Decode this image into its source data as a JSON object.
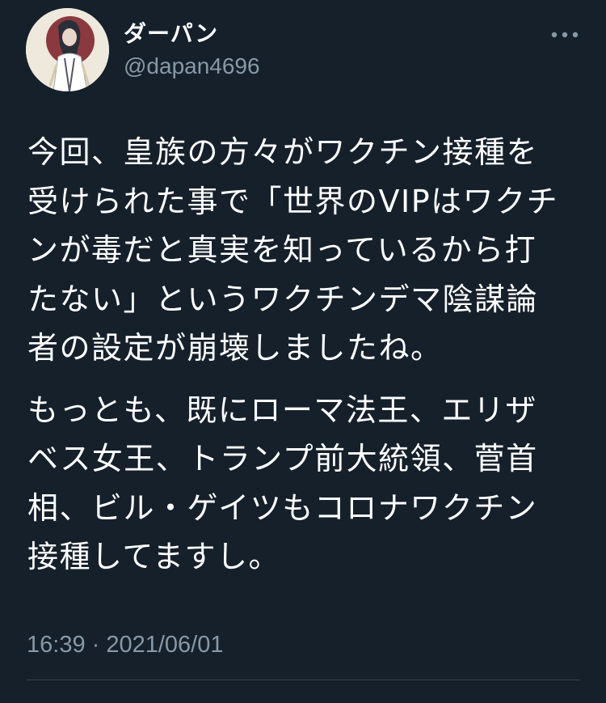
{
  "user": {
    "display_name": "ダーパン",
    "handle": "@dapan4696"
  },
  "icons": {
    "more": "more-horizontal-icon",
    "avatar": "profile-avatar"
  },
  "tweet": {
    "paragraph_1": "今回、皇族の方々がワクチン接種を\n受けられた事で「世界のVIPはワクチ\nンが毒だと真実を知っているから打\nたない」というワクチンデマ陰謀論\n者の設定が崩壊しましたね。",
    "paragraph_2": "もっとも、既にローマ法王、エリザ\nベス女王、トランプ前大統領、菅首\n相、ビル・ゲイツもコロナワクチン\n接種してますし。",
    "timestamp": "16:39 · 2021/06/01"
  },
  "colors": {
    "background": "#15202b",
    "text_primary": "#ffffff",
    "text_secondary": "#8899a6",
    "divider": "#38444d"
  }
}
